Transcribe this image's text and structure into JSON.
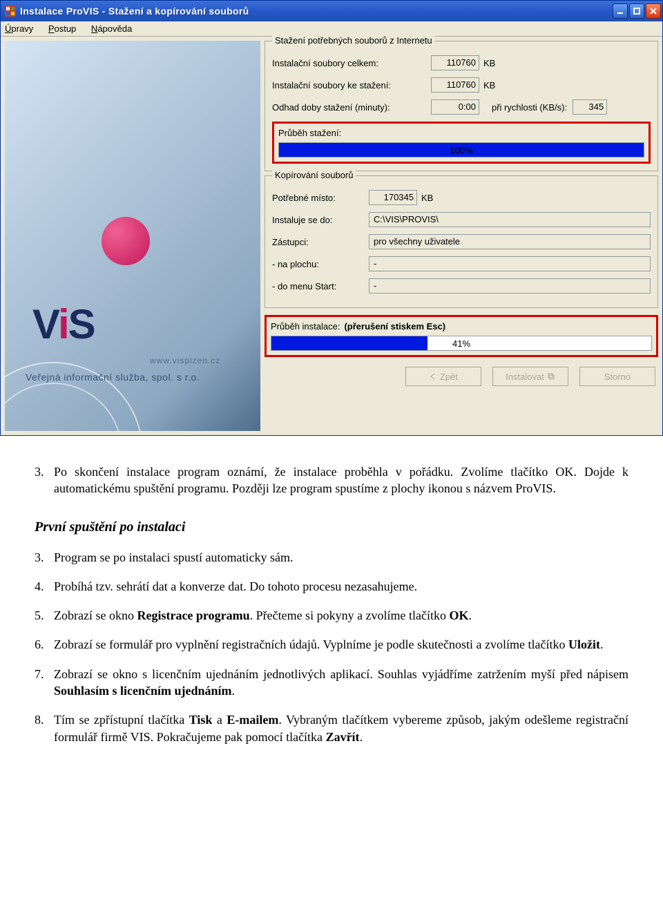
{
  "window": {
    "title": "Instalace ProVIS - Stažení a kopírování souborů",
    "menu": {
      "upravy": "Úpravy",
      "postup": "Postup",
      "napoveda": "Nápověda"
    },
    "side": {
      "brand_v": "V",
      "brand_i": "i",
      "brand_s": "S",
      "url": "www.visplzen.cz",
      "tagline": "Veřejná informační služba, spol. s r.o."
    },
    "download": {
      "legend": "Stažení potřebných souborů z Internetu",
      "total_label": "Instalační soubory celkem:",
      "total_value": "110760",
      "total_unit": "KB",
      "todl_label": "Instalační soubory ke stažení:",
      "todl_value": "110760",
      "todl_unit": "KB",
      "time_label": "Odhad doby stažení (minuty):",
      "time_value": "0:00",
      "speed_label": "při rychlosti (KB/s):",
      "speed_value": "345",
      "progress_label": "Průběh stažení:",
      "progress_pct": "100%"
    },
    "copy": {
      "legend": "Kopírování souborů",
      "space_label": "Potřebné místo:",
      "space_value": "170345",
      "space_unit": "KB",
      "dest_label": "Instaluje se do:",
      "dest_value": "C:\\VIS\\PROVIS\\",
      "shortcuts_label": "Zástupci:",
      "shortcuts_value": "pro všechny uživatele",
      "desktop_label": "- na plochu:",
      "desktop_value": "-",
      "start_label": "- do menu Start:",
      "start_value": "-"
    },
    "install": {
      "label": "Průběh instalace:",
      "hint": "(přerušení stiskem Esc)",
      "pct": "41%"
    },
    "buttons": {
      "back": "Zpět",
      "install": "Instalovat",
      "cancel": "Storno"
    }
  },
  "doc": {
    "step3": "Po skončení instalace program oznámí, že instalace proběhla v pořádku. Zvolíme tlačítko OK. Dojde k automatickému spuštění programu. Později lze program spustíme z plochy ikonou s názvem ProVIS.",
    "heading": "První spuštění po instalaci",
    "s1": "Program se po instalaci spustí automaticky sám.",
    "s2": "Probíhá tzv. sehrátí dat a konverze dat. Do tohoto procesu nezasahujeme.",
    "s3_a": "Zobrazí se okno ",
    "s3_b": "Registrace programu",
    "s3_c": ". Přečteme si pokyny a zvolíme tlačítko ",
    "s3_d": "OK",
    "s3_e": ".",
    "s4_a": "Zobrazí se formulář pro vyplnění registračních údajů. Vyplníme je podle skutečnosti a zvolíme tlačítko ",
    "s4_b": "Uložit",
    "s4_c": ".",
    "s5_a": "Zobrazí se okno s licenčním ujednáním jednotlivých aplikací. Souhlas vyjádříme zatržením myší před nápisem ",
    "s5_b": "Souhlasím s licenčním ujednáním",
    "s5_c": ".",
    "s6_a": "Tím se zpřístupní tlačítka ",
    "s6_b": "Tisk",
    "s6_c": " a ",
    "s6_d": "E-mailem",
    "s6_e": ". Vybraným tlačítkem vybereme způsob, jakým odešleme registrační formulář firmě VIS. Pokračujeme pak pomocí tlačítka ",
    "s6_f": "Zavřít",
    "s6_g": "."
  }
}
